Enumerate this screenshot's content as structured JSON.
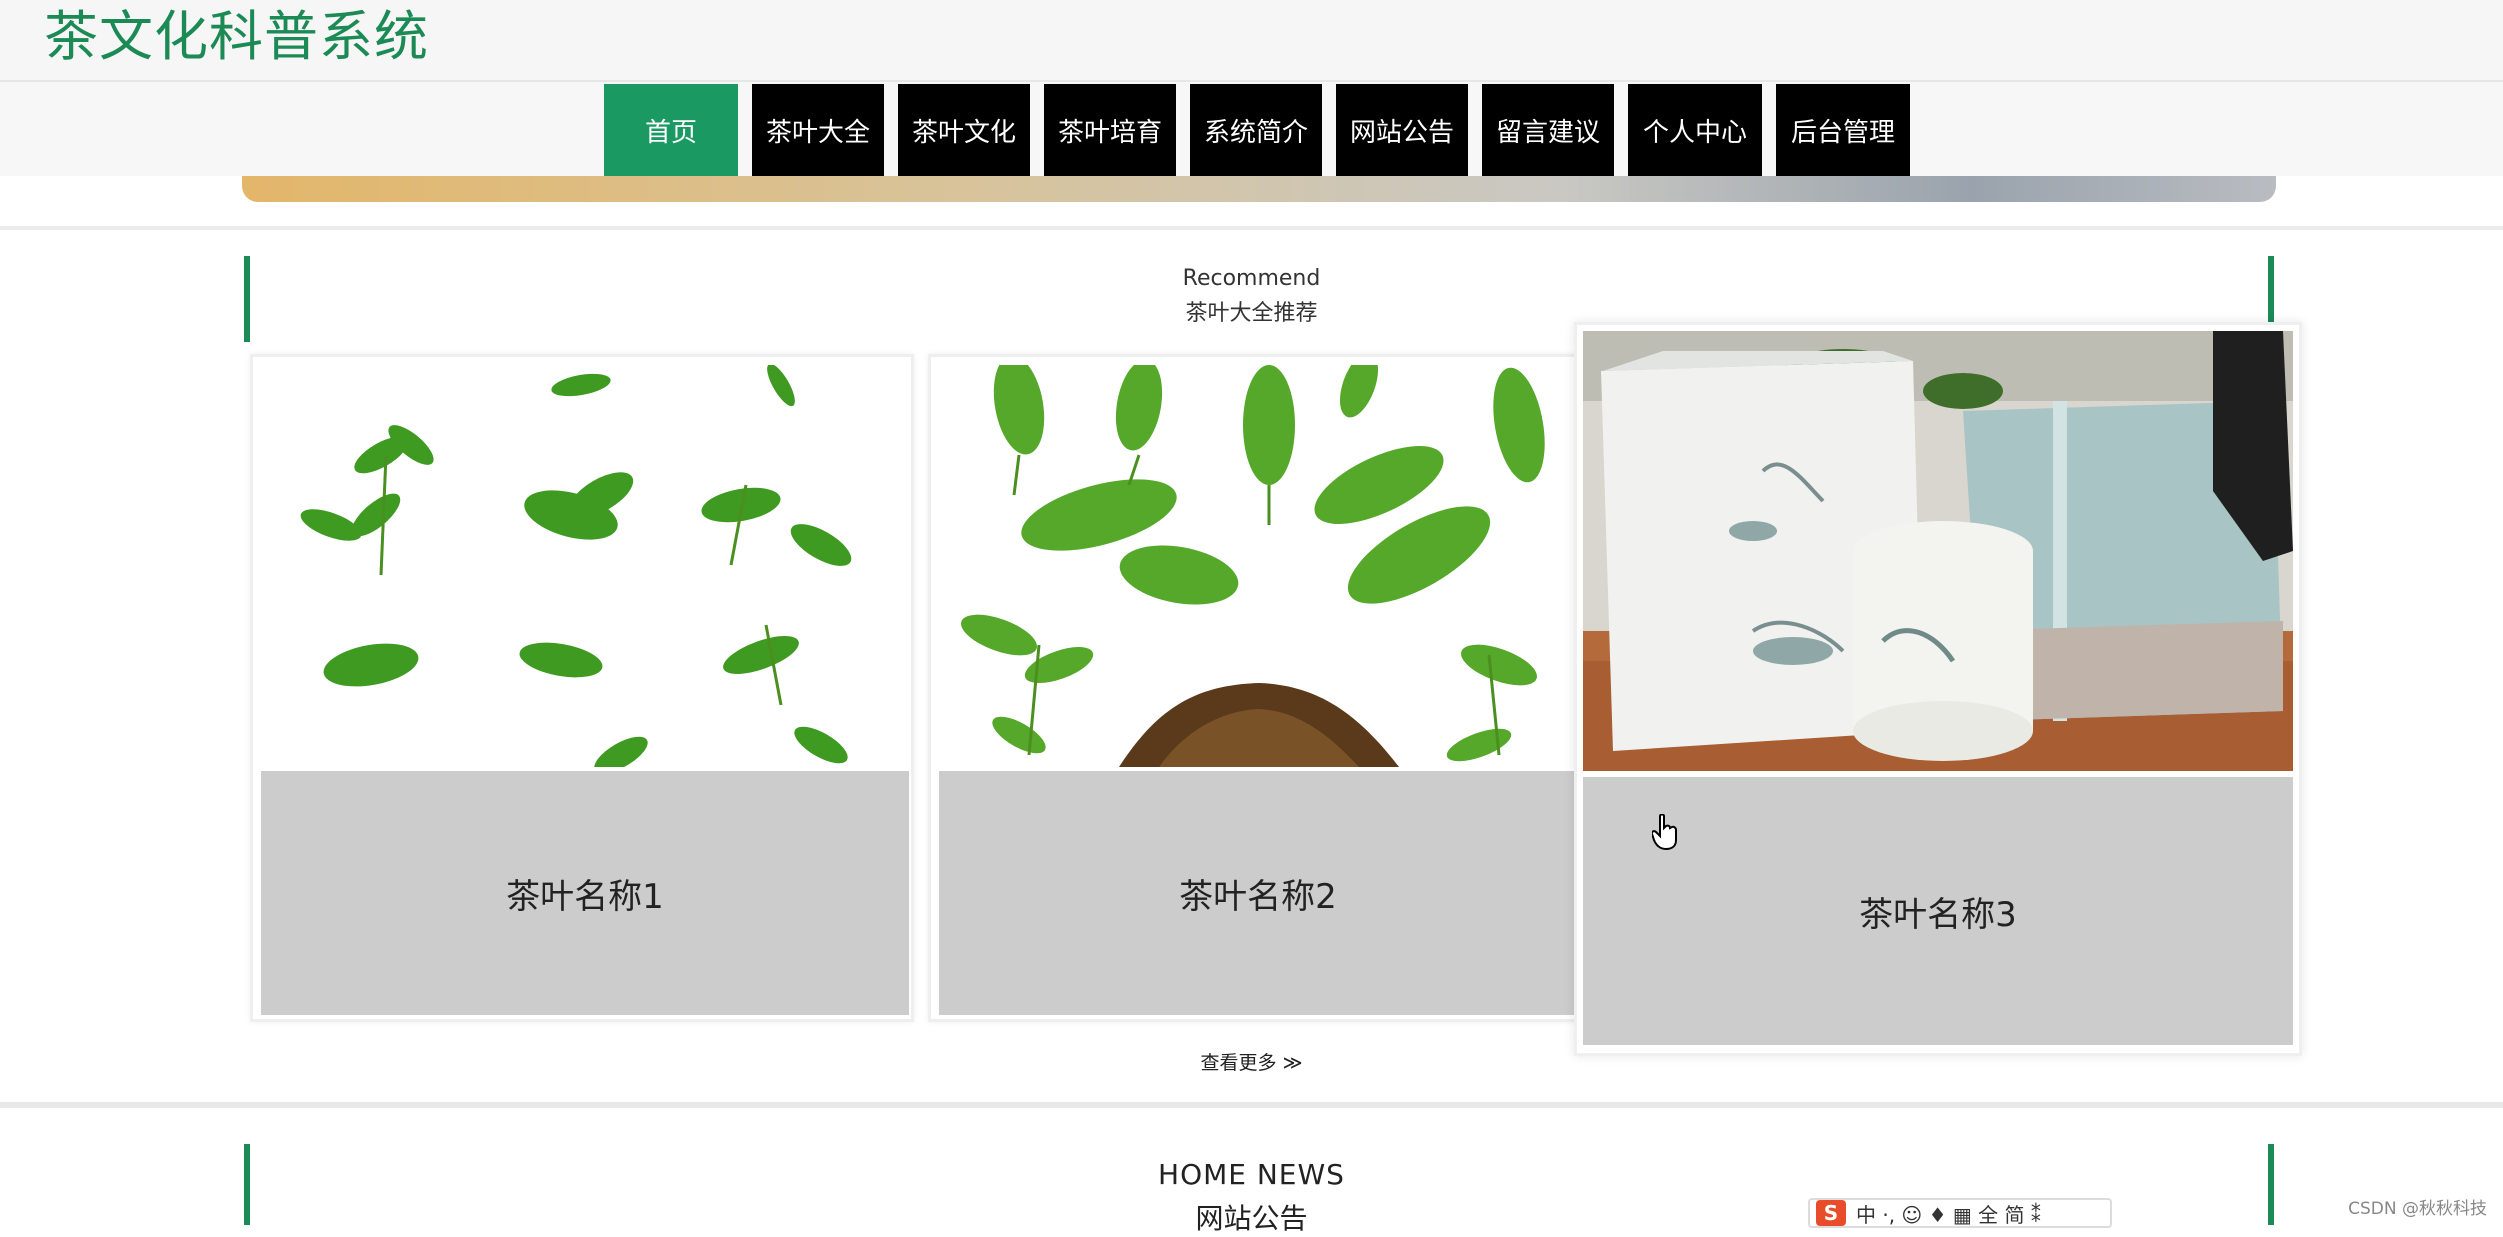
{
  "header": {
    "site_title": "茶文化科普系统"
  },
  "nav": {
    "items": [
      {
        "label": "首页",
        "active": true
      },
      {
        "label": "茶叶大全"
      },
      {
        "label": "茶叶文化"
      },
      {
        "label": "茶叶培育"
      },
      {
        "label": "系统简介"
      },
      {
        "label": "网站公告"
      },
      {
        "label": "留言建议"
      },
      {
        "label": "个人中心"
      },
      {
        "label": "后台管理"
      }
    ]
  },
  "recommend": {
    "title_en": "Recommend",
    "title_cn": "茶叶大全推荐",
    "cards": [
      {
        "name": "茶叶名称1",
        "image": "tea-leaves-scattered-image"
      },
      {
        "name": "茶叶名称2",
        "image": "tea-leaves-with-dry-tea-image"
      },
      {
        "name": "茶叶名称3",
        "image": "tea-gift-box-image"
      }
    ],
    "more_label": "查看更多 ≫"
  },
  "news": {
    "title_en": "HOME NEWS",
    "title_cn": "网站公告"
  },
  "overlay": {
    "ime_label": "中 ·, ☺ ♦ ▦ 全 简 ⁑",
    "ime_logo": "S",
    "watermark": "CSDN @秋秋科技"
  },
  "colors": {
    "brand_green": "#1b8a55",
    "nav_active": "#1a9a62",
    "nav_bg": "#000000",
    "caption_bg": "#cccccc"
  }
}
